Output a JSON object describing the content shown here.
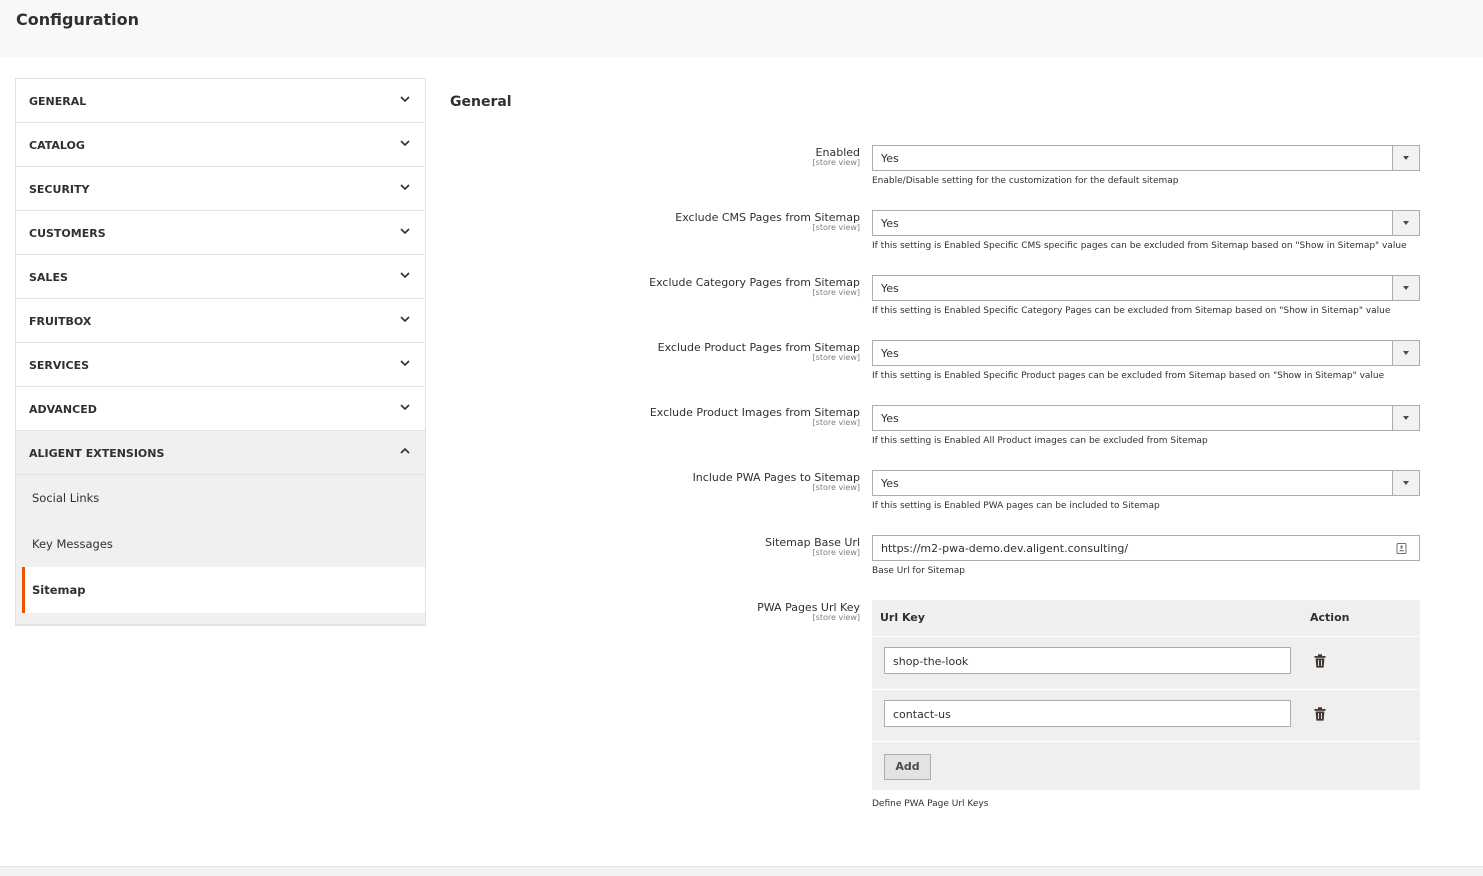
{
  "page": {
    "title": "Configuration"
  },
  "sidebar": {
    "tabs": [
      {
        "label": "GENERAL"
      },
      {
        "label": "CATALOG"
      },
      {
        "label": "SECURITY"
      },
      {
        "label": "CUSTOMERS"
      },
      {
        "label": "SALES"
      },
      {
        "label": "FRUITBOX"
      },
      {
        "label": "SERVICES"
      },
      {
        "label": "ADVANCED"
      },
      {
        "label": "ALIGENT EXTENSIONS"
      }
    ],
    "sub_items": [
      {
        "label": "Social Links"
      },
      {
        "label": "Key Messages"
      },
      {
        "label": "Sitemap"
      }
    ]
  },
  "main": {
    "section_title": "General",
    "scope_label": "[store view]",
    "fields": [
      {
        "label": "Enabled",
        "value": "Yes",
        "note": "Enable/Disable setting for the customization for the default sitemap"
      },
      {
        "label": "Exclude CMS Pages from Sitemap",
        "value": "Yes",
        "note": "If this setting is Enabled Specific CMS specific pages can be excluded from Sitemap based on \"Show in Sitemap\" value"
      },
      {
        "label": "Exclude Category Pages from Sitemap",
        "value": "Yes",
        "note": "If this setting is Enabled Specific Category Pages can be excluded from Sitemap based on \"Show in Sitemap\" value"
      },
      {
        "label": "Exclude Product Pages from Sitemap",
        "value": "Yes",
        "note": "If this setting is Enabled Specific Product pages can be excluded from Sitemap based on \"Show in Sitemap\" value"
      },
      {
        "label": "Exclude Product Images from Sitemap",
        "value": "Yes",
        "note": "If this setting is Enabled All Product images can be excluded from Sitemap"
      },
      {
        "label": "Include PWA Pages to Sitemap",
        "value": "Yes",
        "note": "If this setting is Enabled PWA pages can be included to Sitemap"
      }
    ],
    "base_url": {
      "label": "Sitemap Base Url",
      "value": "https://m2-pwa-demo.dev.aligent.consulting/",
      "note": "Base Url for Sitemap"
    },
    "pwa_pages": {
      "label": "PWA Pages Url Key",
      "col_url_key": "Url Key",
      "col_action": "Action",
      "rows": [
        {
          "value": "shop-the-look"
        },
        {
          "value": "contact-us"
        }
      ],
      "add_label": "Add",
      "note": "Define PWA Page Url Keys"
    }
  },
  "colors": {
    "accent": "#eb5202",
    "header_bg": "#f8f8f8",
    "panel_bg": "#f0f0f0"
  }
}
